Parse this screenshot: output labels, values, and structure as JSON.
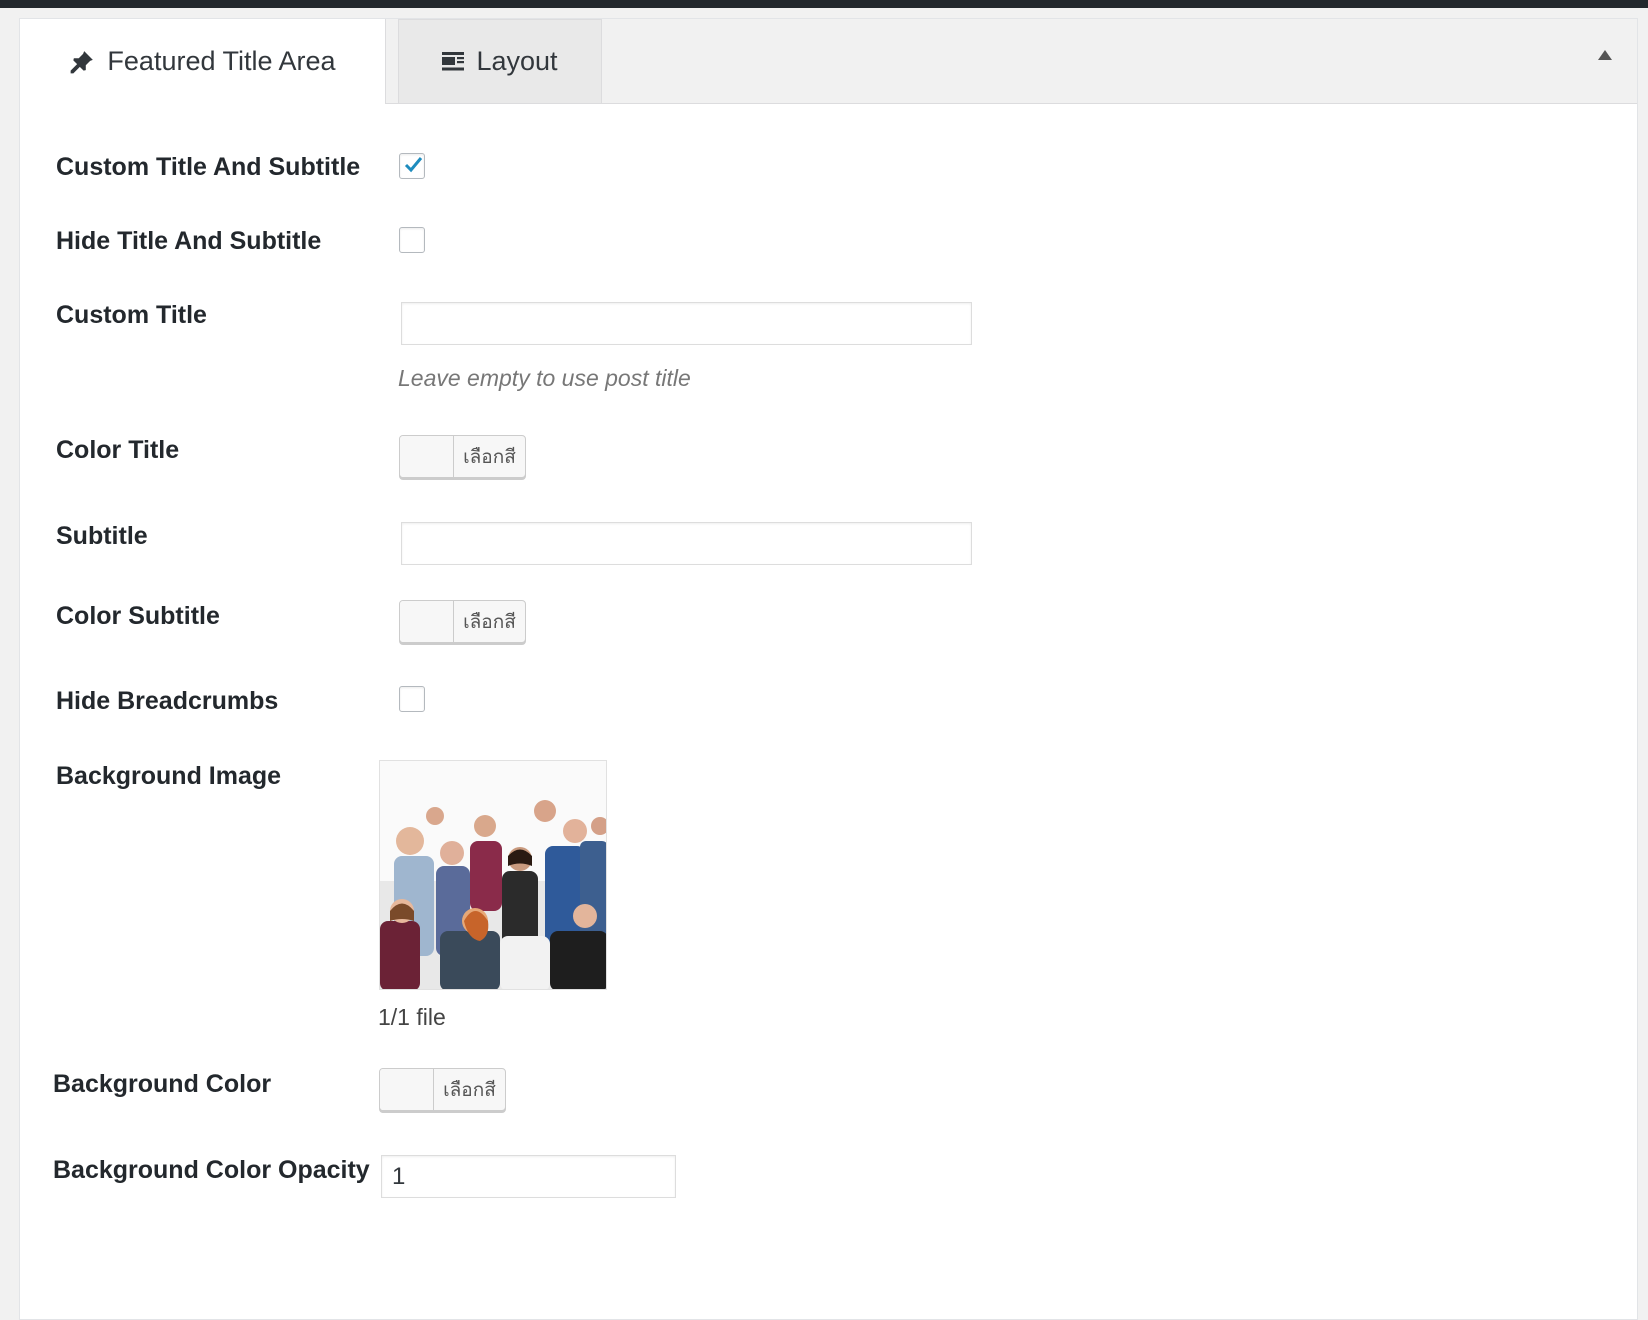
{
  "tabs": {
    "featured_title_area": "Featured Title Area",
    "layout": "Layout"
  },
  "icons": {
    "pin": "pin-icon",
    "layout": "layout-icon",
    "collapse": "triangle-up-icon"
  },
  "fields": {
    "custom_title_and_subtitle": {
      "label": "Custom Title And Subtitle",
      "checked": true
    },
    "hide_title_and_subtitle": {
      "label": "Hide Title And Subtitle",
      "checked": false
    },
    "custom_title": {
      "label": "Custom Title",
      "value": "",
      "hint": "Leave empty to use post title"
    },
    "color_title": {
      "label": "Color Title",
      "button": "เลือกสี"
    },
    "subtitle": {
      "label": "Subtitle",
      "value": ""
    },
    "color_subtitle": {
      "label": "Color Subtitle",
      "button": "เลือกสี"
    },
    "hide_breadcrumbs": {
      "label": "Hide Breadcrumbs",
      "checked": false
    },
    "background_image": {
      "label": "Background Image",
      "file_count": "1/1 file"
    },
    "background_color": {
      "label": "Background Color",
      "button": "เลือกสี"
    },
    "background_color_opacity": {
      "label": "Background Color Opacity",
      "value": "1"
    }
  },
  "colors": {
    "checkmark": "#1e8cbe",
    "admin_bar": "#23282d"
  }
}
